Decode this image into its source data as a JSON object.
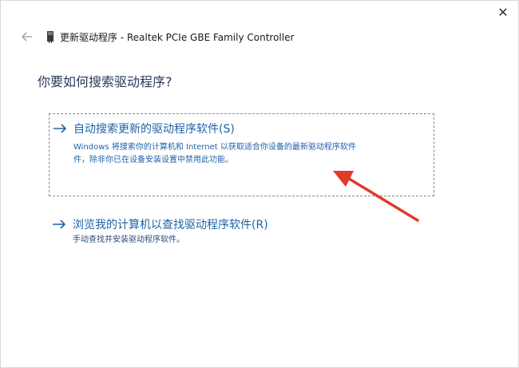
{
  "window": {
    "title": "更新驱动程序 - Realtek PCIe GBE Family Controller",
    "close_glyph": "✕"
  },
  "heading": "你要如何搜索驱动程序?",
  "options": [
    {
      "title": "自动搜索更新的驱动程序软件(S)",
      "description_lines": [
        "Windows 将搜索你的计算机和 Internet 以获取适合你设备的最新驱动程序软件",
        "件，除非你已在设备安装设置中禁用此功能。"
      ],
      "selected": true
    },
    {
      "title": "浏览我的计算机以查找驱动程序软件(R)",
      "description_lines": [
        "手动查找并安装驱动程序软件。"
      ],
      "selected": false
    }
  ],
  "icons": {
    "back": "back-arrow-icon",
    "device": "network-adapter-icon",
    "option_arrow": "right-arrow-icon",
    "annotation": "red-pointer-arrow"
  },
  "colors": {
    "link_blue": "#1f62a8",
    "heading": "#2a3a5a",
    "annotation_red": "#e03a2a"
  }
}
